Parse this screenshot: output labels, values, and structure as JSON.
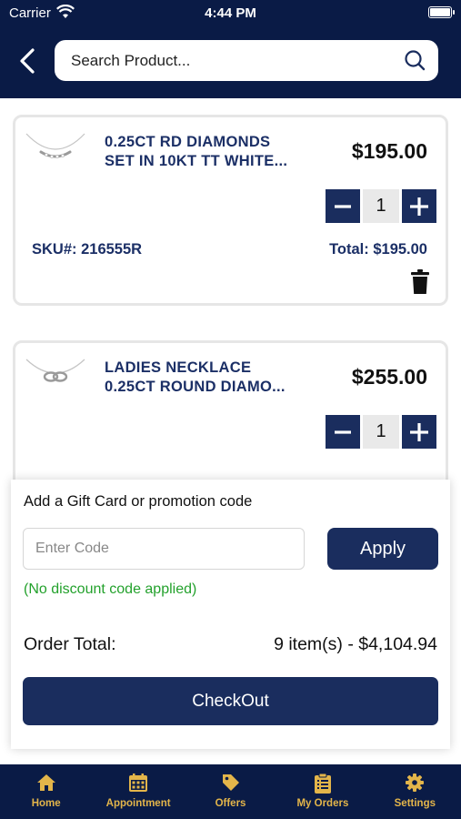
{
  "status_bar": {
    "carrier": "Carrier",
    "time": "4:44 PM"
  },
  "search": {
    "placeholder": "Search Product..."
  },
  "cart_items": [
    {
      "name_line1": "0.25CT RD DIAMONDS",
      "name_line2": "SET IN 10KT TT WHITE...",
      "price": "$195.00",
      "quantity": "1",
      "sku": "SKU#: 216555R",
      "total": "Total: $195.00"
    },
    {
      "name_line1": "LADIES NECKLACE",
      "name_line2": "0.25CT ROUND DIAMO...",
      "price": "$255.00",
      "quantity": "1"
    }
  ],
  "promo": {
    "label": "Add a Gift Card or promotion code",
    "input_placeholder": "Enter Code",
    "apply_label": "Apply",
    "discount_note": "(No discount code applied)"
  },
  "order": {
    "total_label": "Order Total:",
    "total_value": "9 item(s) - $4,104.94",
    "checkout_label": "CheckOut"
  },
  "tabs": [
    {
      "label": "Home",
      "icon": "home-icon"
    },
    {
      "label": "Appointment",
      "icon": "calendar-icon"
    },
    {
      "label": "Offers",
      "icon": "tag-icon"
    },
    {
      "label": "My Orders",
      "icon": "clipboard-icon"
    },
    {
      "label": "Settings",
      "icon": "gear-icon"
    }
  ],
  "colors": {
    "navy": "#0a1b46",
    "button_navy": "#1a2d5e",
    "tab_gold": "#e3b54a",
    "discount_green": "#23a12c"
  }
}
